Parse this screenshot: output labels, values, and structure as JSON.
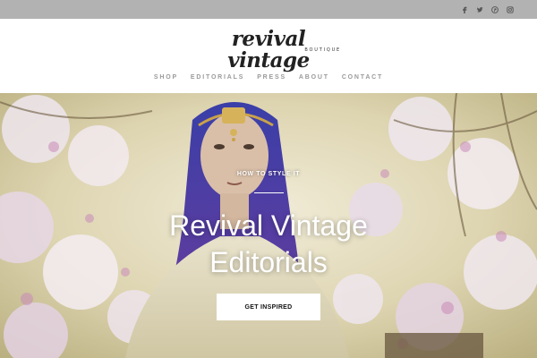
{
  "topbar": {
    "social": [
      {
        "name": "facebook-icon",
        "glyph": "f"
      },
      {
        "name": "twitter-icon",
        "glyph": "t"
      },
      {
        "name": "pinterest-icon",
        "glyph": "p"
      },
      {
        "name": "instagram-icon",
        "glyph": "i"
      }
    ]
  },
  "header": {
    "logo_main": "revival vintage",
    "logo_sub": "BOUTIQUE"
  },
  "nav": {
    "items": [
      "SHOP",
      "EDITORIALS",
      "PRESS",
      "ABOUT",
      "CONTACT"
    ]
  },
  "hero": {
    "kicker": "HOW TO STYLE IT",
    "title_line1": "Revival Vintage",
    "title_line2": "Editorials",
    "cta_label": "GET INSPIRED"
  },
  "colors": {
    "topbar": "#b2b2b2",
    "nav_text": "#9a9a9a",
    "hair": "#4b3fa0"
  }
}
